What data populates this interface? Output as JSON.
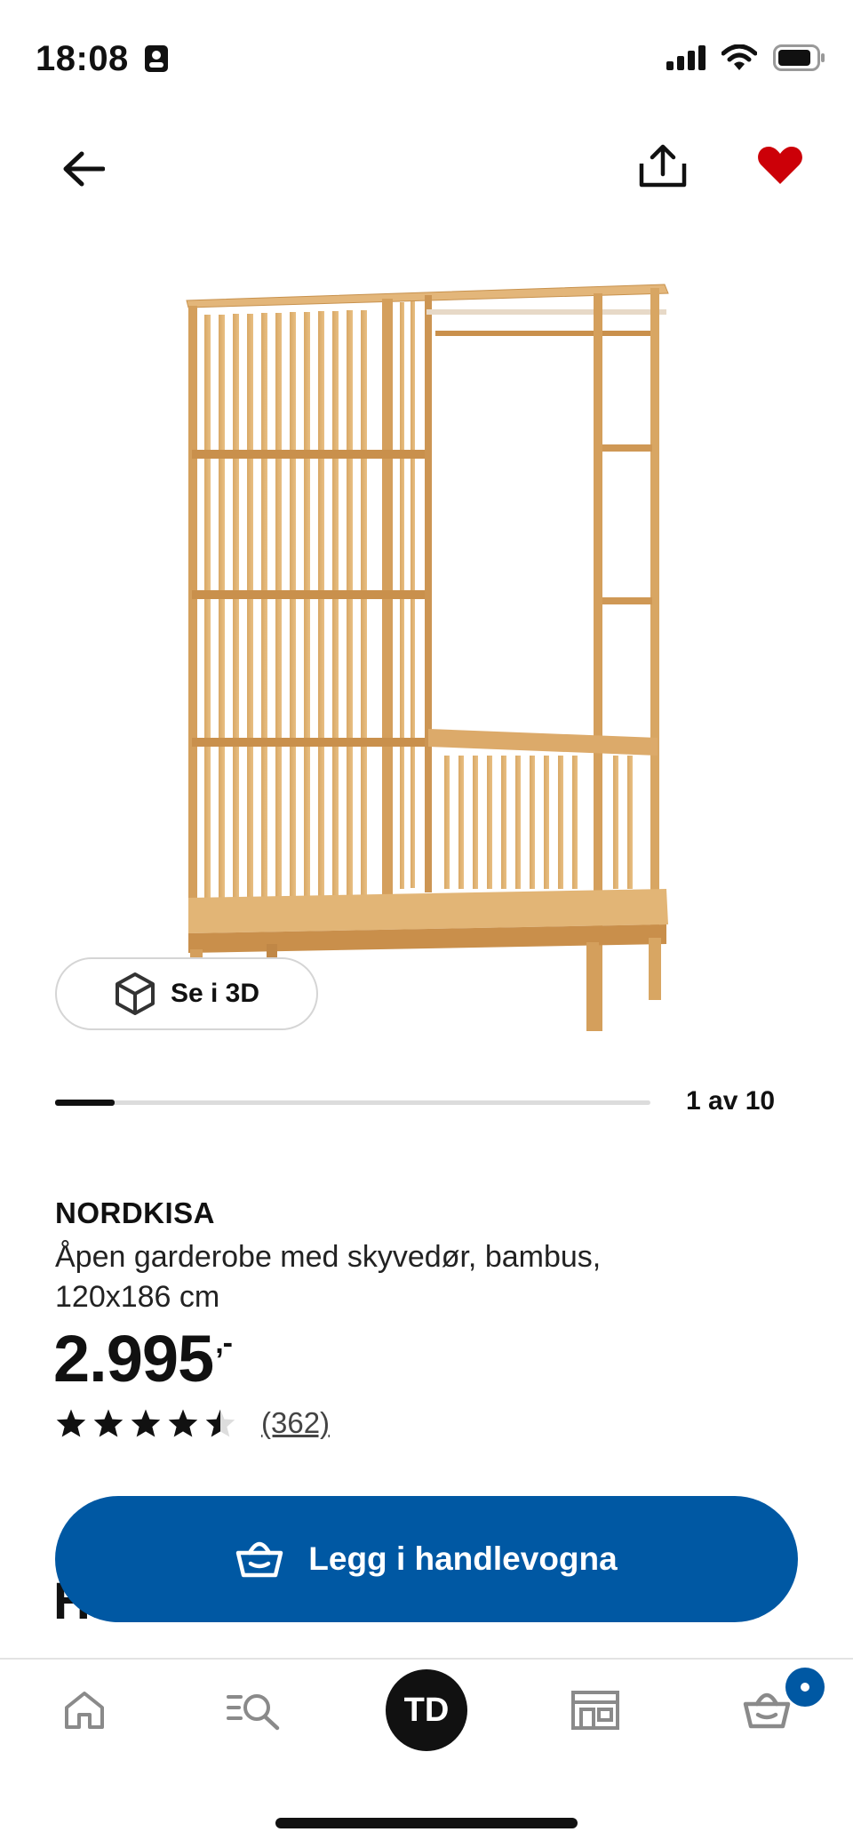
{
  "status_bar": {
    "time": "18:08",
    "icons": [
      "contact-card-icon",
      "signal-icon",
      "wifi-icon",
      "battery-icon"
    ]
  },
  "header": {
    "back_icon": "arrow-left-icon",
    "share_icon": "share-icon",
    "favorite_icon": "heart-icon",
    "favorite_color": "#cc0008"
  },
  "gallery": {
    "view_3d_label": "Se i 3D",
    "current": 1,
    "total": 10,
    "counter_text": "1 av 10"
  },
  "product": {
    "name": "NORDKISA",
    "description": "Åpen garderobe med skyvedør, bambus, 120x186 cm",
    "price": "2.995",
    "price_suffix": ",-",
    "rating": 4.5,
    "rating_max": 5,
    "review_count": "(362)",
    "covered_heading": "H"
  },
  "cart_button": {
    "label": "Legg i handlevogna",
    "icon": "basket-icon",
    "color": "#0058a3"
  },
  "bottom_nav": {
    "items": [
      {
        "name": "home",
        "icon": "home-icon"
      },
      {
        "name": "search",
        "icon": "search-list-icon"
      },
      {
        "name": "profile",
        "avatar_text": "TD"
      },
      {
        "name": "stores",
        "icon": "store-icon"
      },
      {
        "name": "cart",
        "icon": "basket-icon",
        "badge": true
      }
    ]
  }
}
